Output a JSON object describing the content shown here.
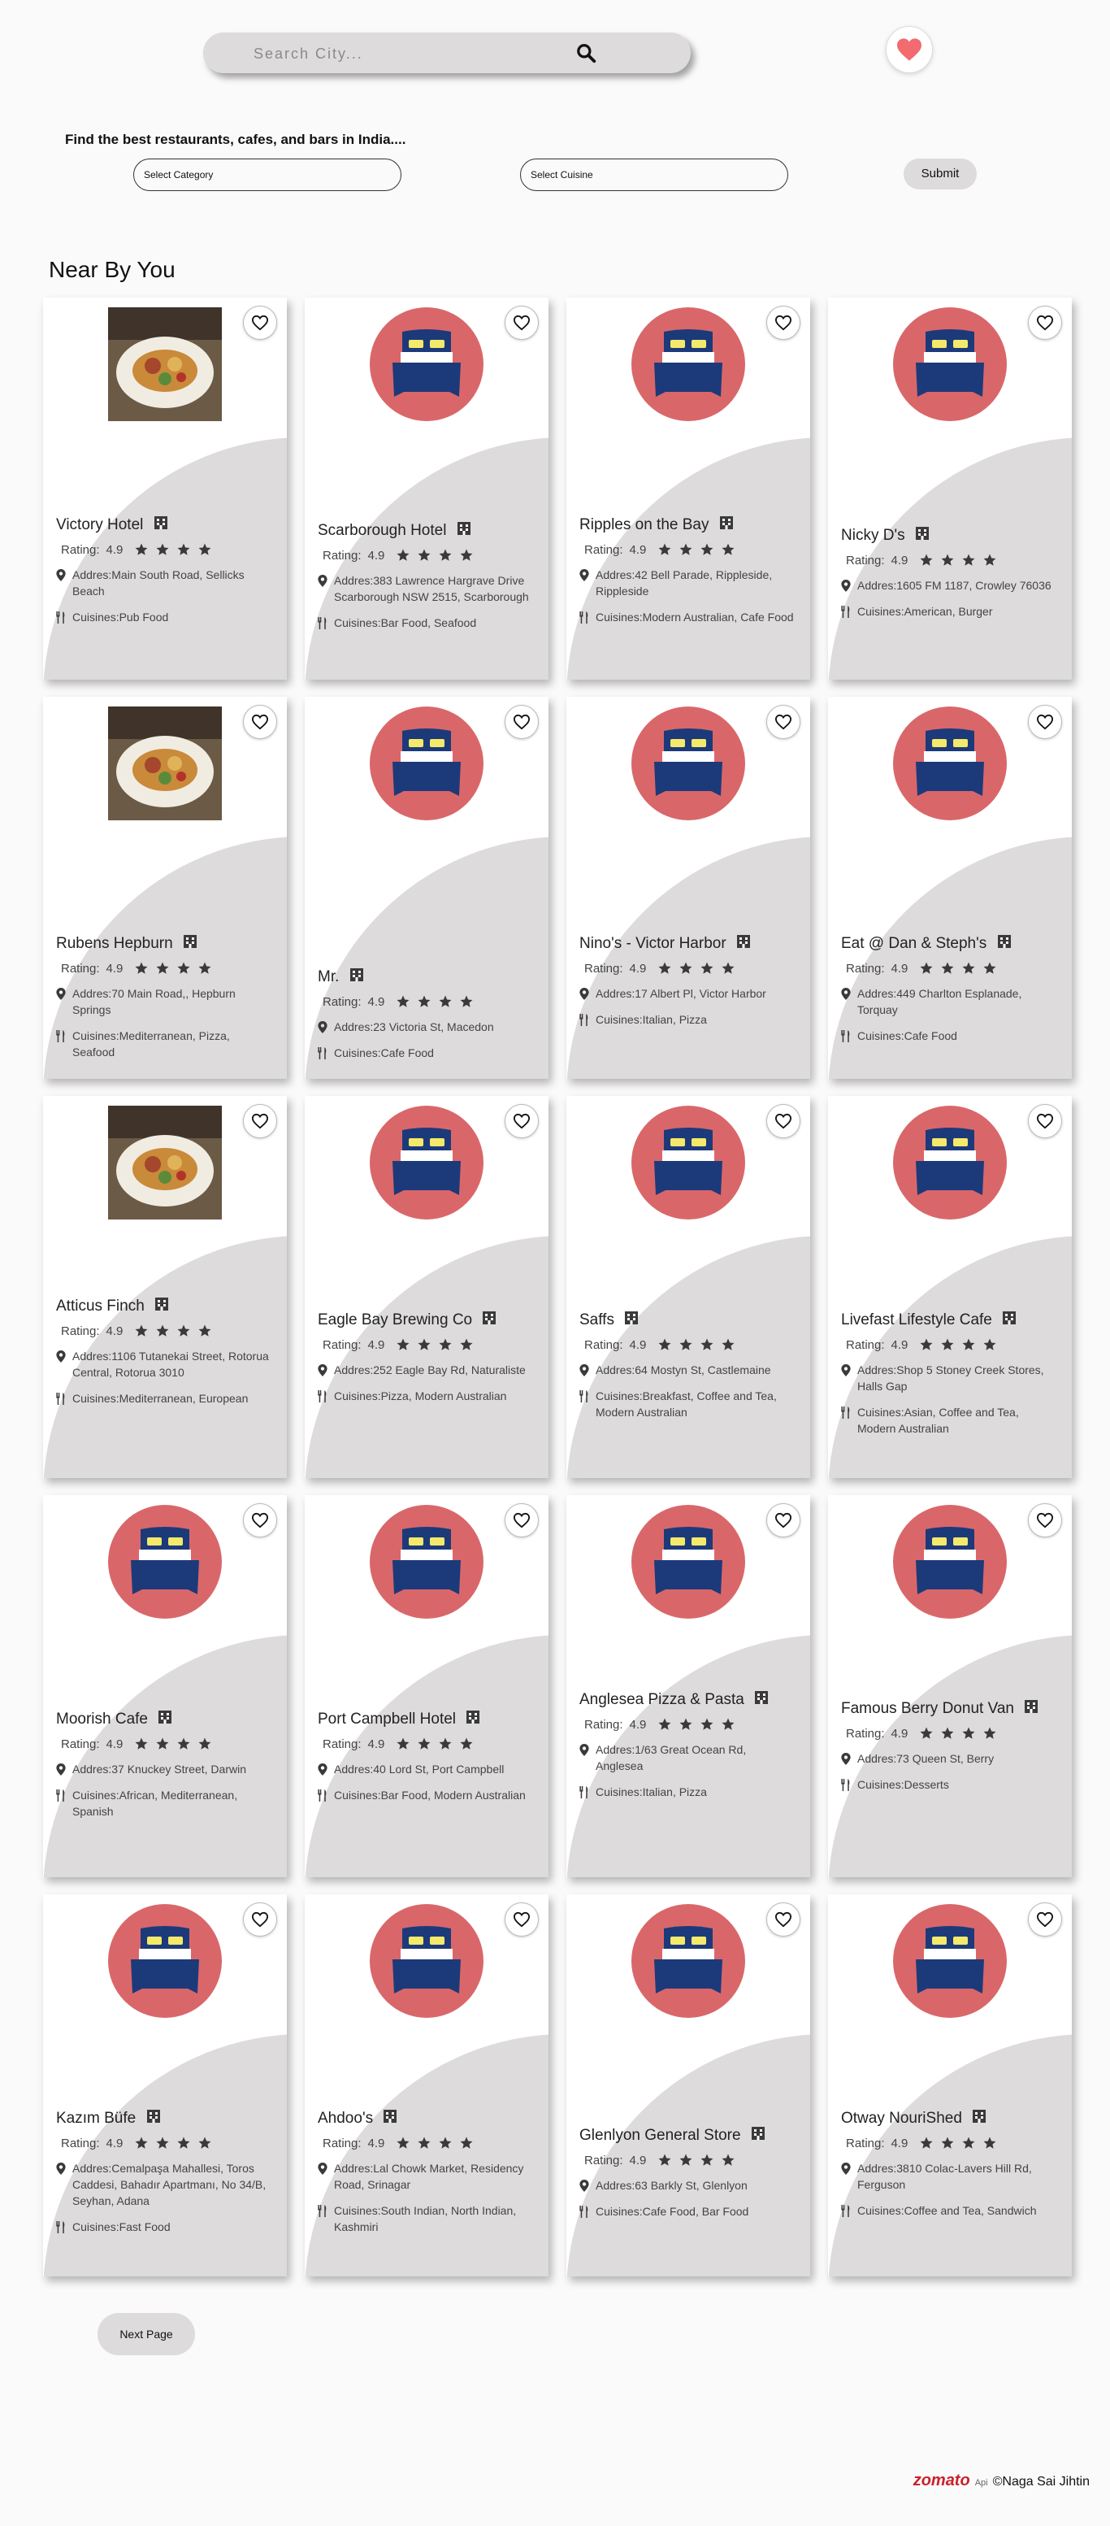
{
  "search": {
    "placeholder": "Search City..."
  },
  "tagline": "Find the best restaurants, cafes, and bars in India....",
  "filters": {
    "category": "Select Category",
    "cuisine": "Select Cuisine",
    "submit": "Submit"
  },
  "section_title": "Near By You",
  "labels": {
    "rating": "Rating:"
  },
  "restaurants": [
    {
      "name": "Victory Hotel",
      "rating": "4.9",
      "stars": 4,
      "address": "Addres:Main South Road, Sellicks Beach",
      "cuisines": "Cuisines:Pub Food",
      "image": "photo-dish"
    },
    {
      "name": "Scarborough Hotel",
      "rating": "4.9",
      "stars": 4,
      "address": "Addres:383 Lawrence Hargrave Drive Scarborough NSW 2515, Scarborough",
      "cuisines": "Cuisines:Bar Food, Seafood",
      "image": "bed-placeholder"
    },
    {
      "name": "Ripples on the Bay",
      "rating": "4.9",
      "stars": 4,
      "address": "Addres:42 Bell Parade, Rippleside, Rippleside",
      "cuisines": "Cuisines:Modern Australian, Cafe Food",
      "image": "bed-placeholder"
    },
    {
      "name": "Nicky D's",
      "rating": "4.9",
      "stars": 4,
      "address": "Addres:1605 FM 1187, Crowley 76036",
      "cuisines": "Cuisines:American, Burger",
      "image": "bed-placeholder"
    },
    {
      "name": "Rubens Hepburn",
      "rating": "4.9",
      "stars": 4,
      "address": "Addres:70 Main Road,, Hepburn Springs",
      "cuisines": "Cuisines:Mediterranean, Pizza, Seafood",
      "image": "photo-dish"
    },
    {
      "name": "Mr.",
      "rating": "4.9",
      "stars": 4,
      "address": "Addres:23 Victoria St, Macedon",
      "cuisines": "Cuisines:Cafe Food",
      "image": "bed-placeholder"
    },
    {
      "name": "Nino's - Victor Harbor",
      "rating": "4.9",
      "stars": 4,
      "address": "Addres:17 Albert Pl, Victor Harbor",
      "cuisines": "Cuisines:Italian, Pizza",
      "image": "bed-placeholder"
    },
    {
      "name": "Eat @ Dan & Steph's",
      "rating": "4.9",
      "stars": 4,
      "address": "Addres:449 Charlton Esplanade, Torquay",
      "cuisines": "Cuisines:Cafe Food",
      "image": "bed-placeholder"
    },
    {
      "name": "Atticus Finch",
      "rating": "4.9",
      "stars": 4,
      "address": "Addres:1106 Tutanekai Street, Rotorua Central, Rotorua 3010",
      "cuisines": "Cuisines:Mediterranean, European",
      "image": "photo-dish"
    },
    {
      "name": "Eagle Bay Brewing Co",
      "rating": "4.9",
      "stars": 4,
      "address": "Addres:252 Eagle Bay Rd, Naturaliste",
      "cuisines": "Cuisines:Pizza, Modern Australian",
      "image": "bed-placeholder"
    },
    {
      "name": "Saffs",
      "rating": "4.9",
      "stars": 4,
      "address": "Addres:64 Mostyn St, Castlemaine",
      "cuisines": "Cuisines:Breakfast, Coffee and Tea, Modern Australian",
      "image": "bed-placeholder"
    },
    {
      "name": "Livefast Lifestyle Cafe",
      "rating": "4.9",
      "stars": 4,
      "address": "Addres:Shop 5 Stoney Creek Stores, Halls Gap",
      "cuisines": "Cuisines:Asian, Coffee and Tea, Modern Australian",
      "image": "bed-placeholder"
    },
    {
      "name": "Moorish Cafe",
      "rating": "4.9",
      "stars": 4,
      "address": "Addres:37 Knuckey Street, Darwin",
      "cuisines": "Cuisines:African, Mediterranean, Spanish",
      "image": "bed-placeholder"
    },
    {
      "name": "Port Campbell Hotel",
      "rating": "4.9",
      "stars": 4,
      "address": "Addres:40 Lord St, Port Campbell",
      "cuisines": "Cuisines:Bar Food, Modern Australian",
      "image": "bed-placeholder"
    },
    {
      "name": "Anglesea Pizza & Pasta",
      "rating": "4.9",
      "stars": 4,
      "address": "Addres:1/63 Great Ocean Rd, Anglesea",
      "cuisines": "Cuisines:Italian, Pizza",
      "image": "bed-placeholder"
    },
    {
      "name": "Famous Berry Donut Van",
      "rating": "4.9",
      "stars": 4,
      "address": "Addres:73 Queen St, Berry",
      "cuisines": "Cuisines:Desserts",
      "image": "bed-placeholder"
    },
    {
      "name": "Kazım Büfe",
      "rating": "4.9",
      "stars": 4,
      "address": "Addres:Cemalpaşa Mahallesi, Toros Caddesi, Bahadır Apartmanı, No 34/B, Seyhan, Adana",
      "cuisines": "Cuisines:Fast Food",
      "image": "bed-placeholder"
    },
    {
      "name": "Ahdoo's",
      "rating": "4.9",
      "stars": 4,
      "address": "Addres:Lal Chowk Market, Residency Road, Srinagar",
      "cuisines": "Cuisines:South Indian, North Indian, Kashmiri",
      "image": "bed-placeholder"
    },
    {
      "name": "Glenlyon General Store",
      "rating": "4.9",
      "stars": 4,
      "address": "Addres:63 Barkly St, Glenlyon",
      "cuisines": "Cuisines:Cafe Food, Bar Food",
      "image": "bed-placeholder"
    },
    {
      "name": "Otway NouriShed",
      "rating": "4.9",
      "stars": 4,
      "address": "Addres:3810 Colac-Lavers Hill Rd, Ferguson",
      "cuisines": "Cuisines:Coffee and Tea, Sandwich",
      "image": "bed-placeholder"
    }
  ],
  "next_page": "Next Page",
  "footer": {
    "brand": "zomato",
    "api": "Api",
    "credit": "©Naga Sai Jihtin"
  },
  "colors": {
    "accent_red": "#cb202d",
    "placeholder_circle": "#d9676a",
    "bed_blue": "#1c3a7a",
    "pillow_yellow": "#f4e96a",
    "card_shape_gray": "#dddbdc"
  }
}
